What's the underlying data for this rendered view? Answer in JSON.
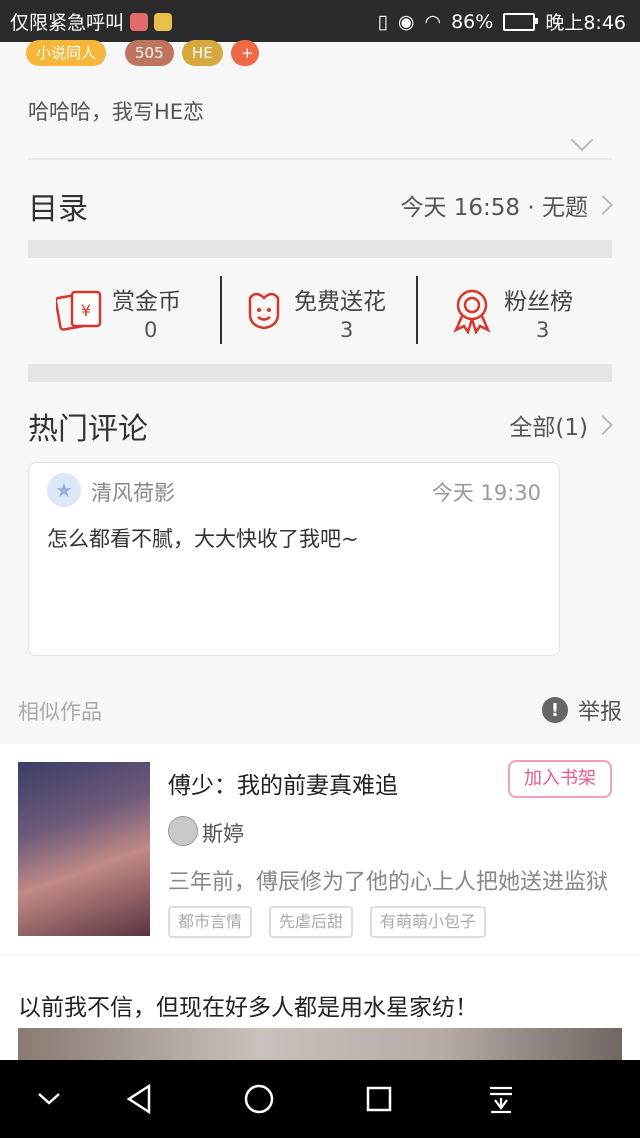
{
  "status_bar": {
    "left_text": "仅限紧急呼叫",
    "battery": "86%",
    "time": "晚上8:46"
  },
  "tags": [
    "小说同人",
    "505",
    "HE",
    "+"
  ],
  "description": "哈哈哈，我写HE恋",
  "catalog": {
    "title": "目录",
    "latest": "今天 16:58 · 无题"
  },
  "stats": [
    {
      "label": "赏金币",
      "value": "0",
      "icon": "red-envelope-icon"
    },
    {
      "label": "免费送花",
      "value": "3",
      "icon": "flower-icon"
    },
    {
      "label": "粉丝榜",
      "value": "3",
      "icon": "medal-icon"
    }
  ],
  "hot_comments": {
    "title": "热门评论",
    "all_label": "全部(1)",
    "comment": {
      "user": "清风荷影",
      "time": "今天 19:30",
      "text": "怎么都看不腻，大大快收了我吧~"
    }
  },
  "similar": {
    "label": "相似作品",
    "report": "举报"
  },
  "book": {
    "title": "傅少：我的前妻真难追",
    "add_shelf": "加入书架",
    "author": "斯婷",
    "desc": "三年前，傅辰修为了他的心上人把她送进监狱",
    "tags": [
      "都市言情",
      "先虐后甜",
      "有萌萌小包子"
    ]
  },
  "ad": {
    "title": "以前我不信，但现在好多人都是用水星家纺！"
  },
  "colors": {
    "tag_novel": "#f5b63a",
    "tag_count": "#c0745d",
    "tag_he": "#d7a83e",
    "tag_plus": "#ee6a45",
    "accent_red": "#d7372a",
    "shelf_pink": "#e95a8c"
  }
}
